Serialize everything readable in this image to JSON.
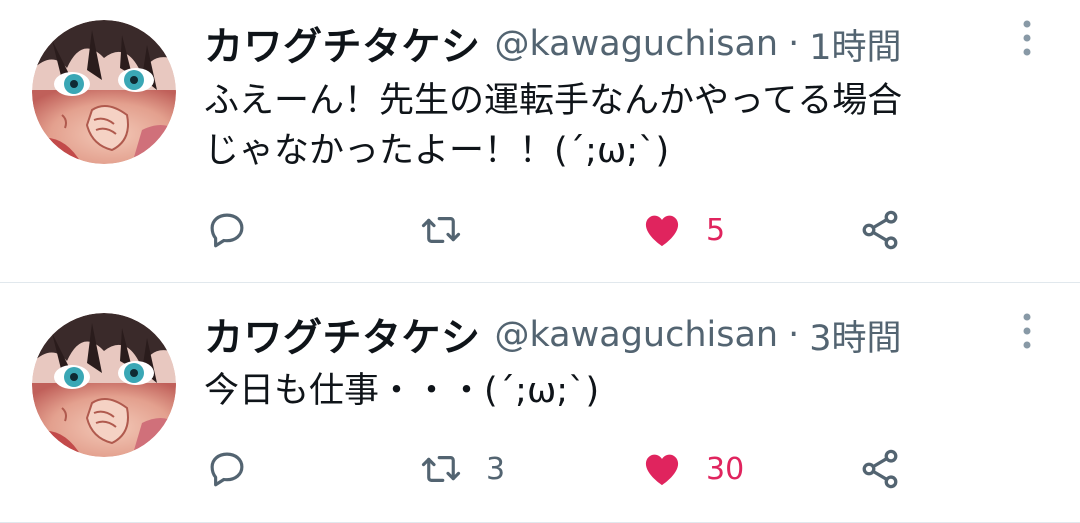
{
  "tweets": [
    {
      "author_name": "カワグチタケシ",
      "handle": "@kawaguchisan",
      "separator": "·",
      "time": "1時間",
      "text_lines": [
        "ふえーん！先生の運転手なんかやってる場合",
        "じゃなかったよー！！(´;ω;`)"
      ],
      "reply_count": "",
      "retweet_count": "",
      "like_count": "5",
      "liked": true
    },
    {
      "author_name": "カワグチタケシ",
      "handle": "@kawaguchisan",
      "separator": "·",
      "time": "3時間",
      "text_lines": [
        "今日も仕事・・・(´;ω;`)"
      ],
      "reply_count": "",
      "retweet_count": "3",
      "like_count": "30",
      "liked": true
    }
  ],
  "icons": {
    "reply": "reply-icon",
    "retweet": "retweet-icon",
    "like": "heart-icon",
    "share": "share-icon",
    "more": "more-vertical-icon"
  },
  "colors": {
    "like": "#e0245e",
    "muted": "#536471",
    "text": "#0f1419",
    "divider": "#e1e8ed"
  }
}
